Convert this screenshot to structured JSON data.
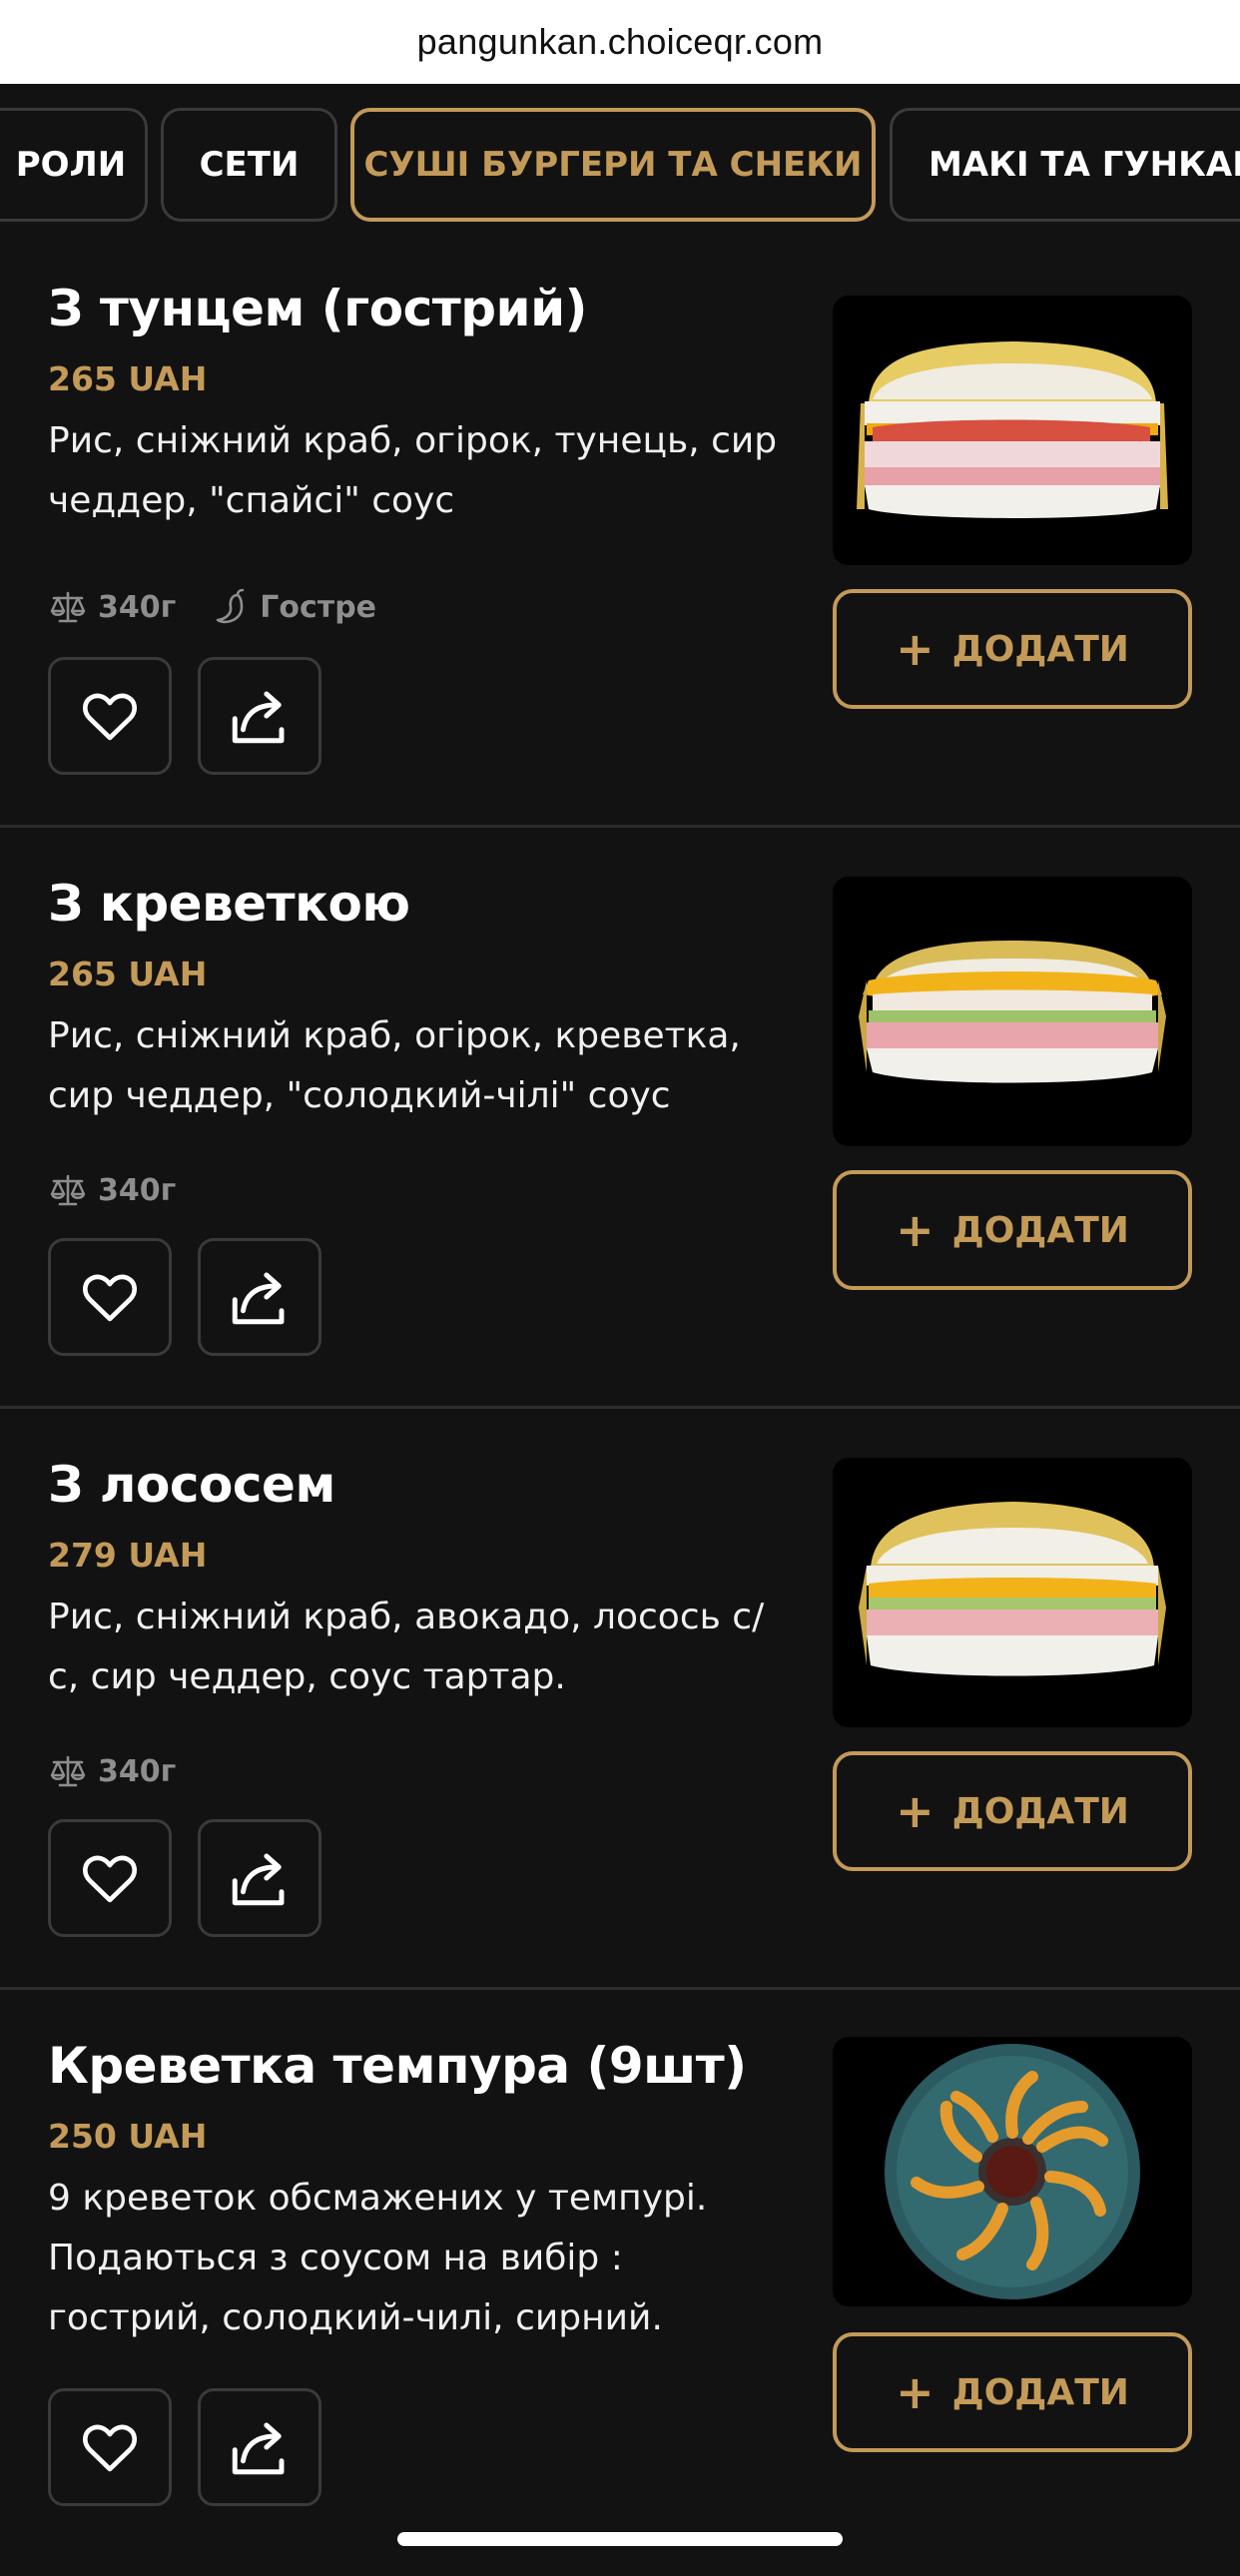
{
  "browser": {
    "url": "pangunkan.choiceqr.com"
  },
  "tabs": [
    {
      "label": "РОЛИ",
      "active": false
    },
    {
      "label": "СЕТИ",
      "active": false
    },
    {
      "label": "СУШІ БУРГЕРИ ТА СНЕКИ",
      "active": true
    },
    {
      "label": "МАКІ ТА ГУНКАНИ",
      "active": false
    }
  ],
  "colors": {
    "accent": "#c39a58",
    "background": "#121212",
    "border": "#3a3a3a"
  },
  "items": [
    {
      "title": "З тунцем (гострий)",
      "price": "265 UAH",
      "description": "Рис, сніжний краб, огірок, тунець, сир чеддер, \"спайсі\" соус",
      "weight": "340г",
      "tag": "Гостре",
      "add_label": "ДОДАТИ",
      "image": "sushi-burger-tuna"
    },
    {
      "title": "З креветкою",
      "price": "265 UAH",
      "description": "Рис, сніжний краб, огірок, креветка, сир чеддер, \"солодкий-чілі\" соус",
      "weight": "340г",
      "add_label": "ДОДАТИ",
      "image": "sushi-burger-shrimp"
    },
    {
      "title": "З лососем",
      "price": "279 UAH",
      "description": "Рис, сніжний краб, авокадо, лосось с/ с, сир чеддер, соус тартар.",
      "weight": "340г",
      "add_label": "ДОДАТИ",
      "image": "sushi-burger-salmon"
    },
    {
      "title": "Креветка темпура (9шт)",
      "price": "250 UAH",
      "description": "9 креветок обсмажених у темпурі. Подаються з соусом на вибір : гострий, солодкий-чилі, сирний.",
      "add_label": "ДОДАТИ",
      "image": "tempura-shrimp-plate"
    }
  ],
  "icons": {
    "weight": "scale-icon",
    "spicy": "chili-icon",
    "favorite": "heart-icon",
    "share": "share-icon",
    "add": "plus-icon"
  }
}
